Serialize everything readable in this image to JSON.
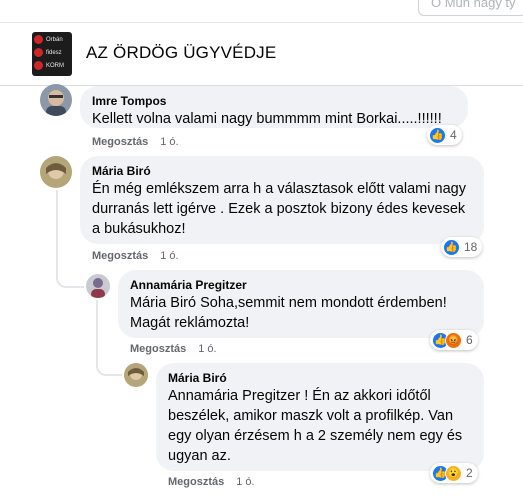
{
  "search": {
    "placeholder": "Ó Mun nagy ty"
  },
  "page": {
    "title": "AZ ÖRDÖG ÜGYVÉDJE",
    "logo_lines": [
      "Orbán",
      "fidesz",
      "KORM"
    ]
  },
  "comments": [
    {
      "author": "Imre Tompos",
      "text": "Kellett volna valami nagy bummmm mint Borkai.....!!!!!!",
      "share": "Megosztás",
      "age": "1 ó.",
      "reaction_count": "4"
    },
    {
      "author": "Mária Biró",
      "text": "Én még emlékszem arra h a választasok előtt valami nagy durranás lett igérve . Ezek a posztok bizony édes kevesek a bukásukhoz!",
      "share": "Megosztás",
      "age": "1 ó.",
      "reaction_count": "18"
    },
    {
      "author": "Annamária Pregitzer",
      "text": "Mária Biró Soha,semmit nem mondott érdemben! Magát reklámozta!",
      "share": "Megosztás",
      "age": "1 ó.",
      "reaction_count": "6"
    },
    {
      "author": "Mária Biró",
      "text": "Annamária Pregitzer ! Én az akkori időtől beszélek, amikor maszk volt a profilkép. Van egy olyan érzésem h a 2 személy nem egy és ugyan az.",
      "share": "Megosztás",
      "age": "1 ó.",
      "reaction_count": "2"
    }
  ],
  "colors": {
    "like": "#1877f2",
    "angry": "#e9710f",
    "wow": "#f7b125",
    "bubble": "#f0f2f5",
    "meta": "#65676b"
  }
}
